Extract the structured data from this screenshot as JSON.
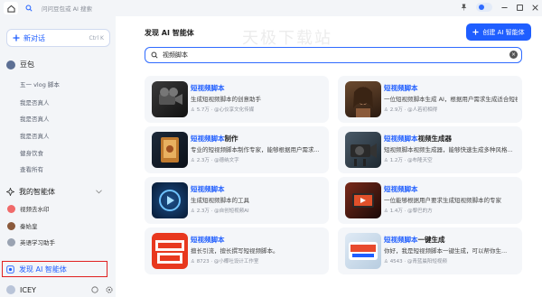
{
  "titlebar": {
    "search_placeholder": "问问豆包或 AI 搜索"
  },
  "sidebar": {
    "new_chat_label": "新对话",
    "new_chat_shortcut": "Ctrl K",
    "bot_name": "豆包",
    "history": [
      "五一 vlog 脚本",
      "我是否真人",
      "我是否真人",
      "我是否真人",
      "健身饮食",
      "查看所有"
    ],
    "my_agents_title": "我的智能体",
    "my_agents": [
      {
        "name": "视频去水印",
        "color": "#f06a6a"
      },
      {
        "name": "秦始皇",
        "color": "#8b5a3c"
      },
      {
        "name": "英语学习助手",
        "color": "#9aa3b2"
      }
    ],
    "discover_label": "发现 AI 智能体",
    "user_name": "ICEY"
  },
  "main": {
    "page_title": "发现 AI 智能体",
    "create_button": "创建 AI 智能体",
    "watermark": "天极下载站",
    "search_value": "视频脚本",
    "cards": [
      {
        "title_hl": "短视频脚本",
        "title_rest": "",
        "desc": "生成短视频脚本的创意助手",
        "meta": "5.7万 · @心仪享文化传媒"
      },
      {
        "title_hl": "短视频脚本",
        "title_rest": "",
        "desc": "一位短视频脚本生成 AI，根据用户需求生成适合短视...",
        "meta": "2.9万 · @人若初相得"
      },
      {
        "title_hl": "短视频脚本",
        "title_rest": "制作",
        "desc": "专业的短视频脚本制作专家，能够根据用户需求...",
        "meta": "2.3万 · @德纳文字"
      },
      {
        "title_hl": "短视频脚本",
        "title_rest": "视频生成器",
        "desc": "短视频脚本视频生成器，能够快速生成多种风格...",
        "meta": "1.2万 · @布隆天空"
      },
      {
        "title_hl": "短视频脚本",
        "title_rest": "",
        "desc": "生成短视频脚本的工具",
        "meta": "2.3万 · @自创短视频AI"
      },
      {
        "title_hl": "短视频脚本",
        "title_rest": "",
        "desc": "一位能够根据用户要求生成短视频脚本的专家",
        "meta": "1.4万 · @黎巴的方"
      },
      {
        "title_hl": "短视频脚本",
        "title_rest": "",
        "desc": "擅长引流，擅长撰写短视频脚本。",
        "meta": "8723 · @小椰吐设计工作室"
      },
      {
        "title_hl": "短视频脚本",
        "title_rest": "一键生成",
        "desc": "你好，我是短视频脚本一键生成，可以帮你生...",
        "meta": "4543 · @青蓝晨阳短视频"
      }
    ]
  }
}
